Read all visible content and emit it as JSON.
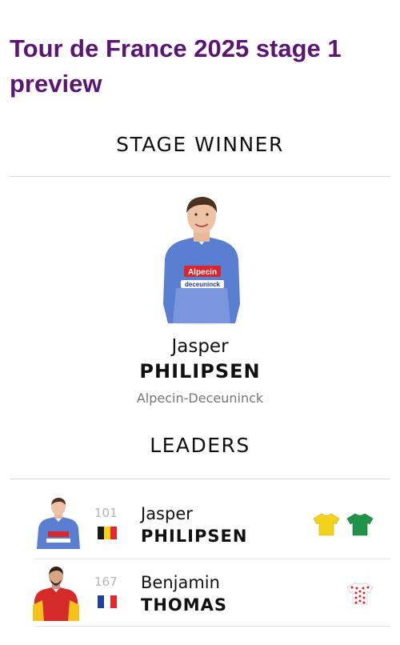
{
  "page": {
    "title": "Tour de France 2025 stage 1 preview"
  },
  "stage_winner": {
    "heading": "STAGE WINNER",
    "first_name": "Jasper",
    "last_name": "PHILIPSEN",
    "team": "Alpecin-Deceuninck"
  },
  "leaders": {
    "heading": "LEADERS",
    "rows": [
      {
        "bib": "101",
        "first_name": "Jasper",
        "last_name": "PHILIPSEN",
        "flag": "belgium-flag",
        "jerseys": [
          "yellow-jersey-icon",
          "green-jersey-icon"
        ]
      },
      {
        "bib": "167",
        "first_name": "Benjamin",
        "last_name": "THOMAS",
        "flag": "france-flag",
        "jerseys": [
          "polka-dot-jersey-icon"
        ]
      }
    ]
  },
  "colors": {
    "title": "#5b1674",
    "alpecin_blue": "#5a7fd0",
    "yellow_jersey": "#f2d21b",
    "green_jersey": "#1f9448",
    "polka_red": "#d9232e"
  }
}
